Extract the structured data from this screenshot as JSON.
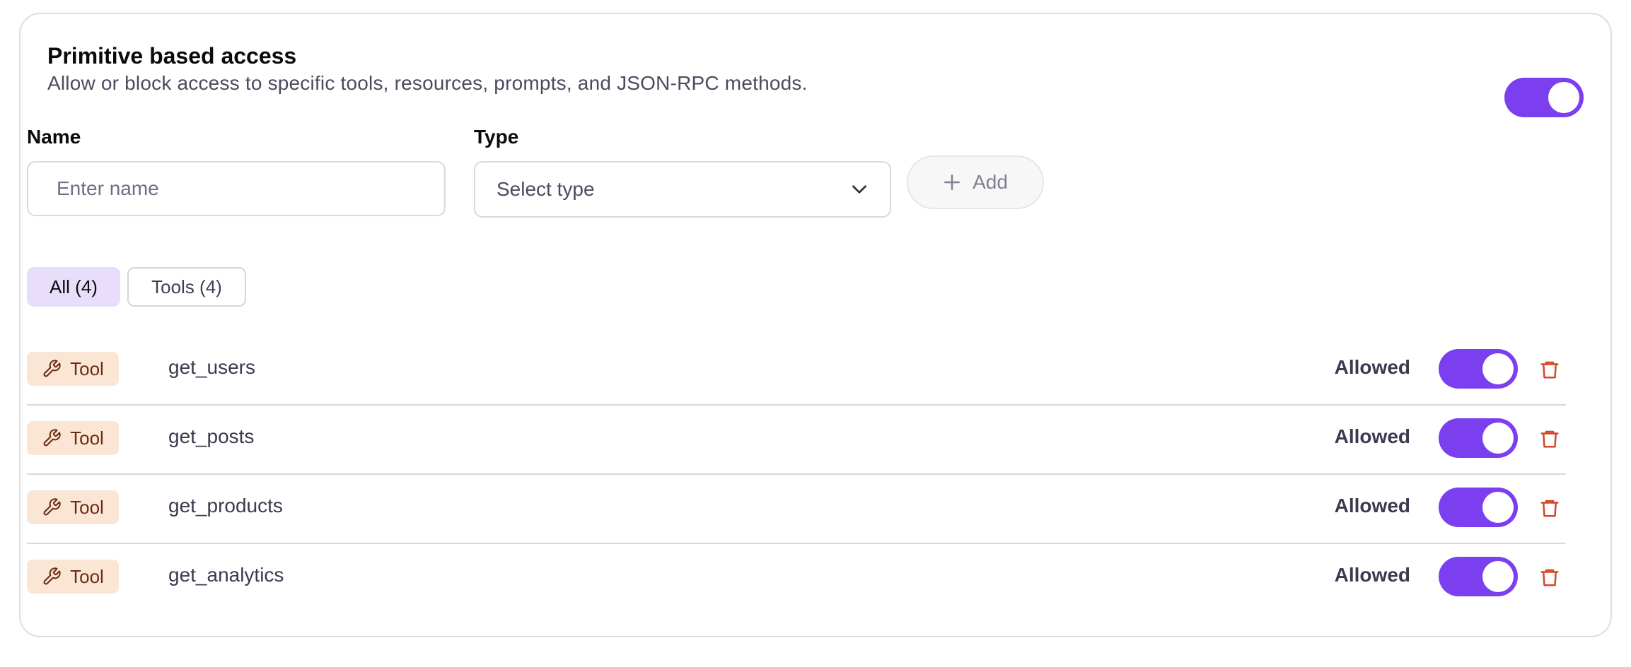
{
  "header": {
    "title": "Primitive based access",
    "subtitle": "Allow or block access to specific tools, resources, prompts, and JSON-RPC methods.",
    "enabled": true
  },
  "form": {
    "name_label": "Name",
    "name_placeholder": "Enter name",
    "name_value": "",
    "type_label": "Type",
    "type_selected": "Select type",
    "add_label": "Add"
  },
  "filters": [
    {
      "label": "All (4)",
      "active": true
    },
    {
      "label": "Tools (4)",
      "active": false
    }
  ],
  "rows": [
    {
      "type": "Tool",
      "name": "get_users",
      "status": "Allowed",
      "enabled": true
    },
    {
      "type": "Tool",
      "name": "get_posts",
      "status": "Allowed",
      "enabled": true
    },
    {
      "type": "Tool",
      "name": "get_products",
      "status": "Allowed",
      "enabled": true
    },
    {
      "type": "Tool",
      "name": "get_analytics",
      "status": "Allowed",
      "enabled": true
    }
  ],
  "icons": {
    "row_type": "wrench-icon",
    "delete": "trash-icon",
    "add": "plus-icon",
    "select": "chevron-down-icon"
  },
  "colors": {
    "accent": "#7b3ff0",
    "badge_bg": "#fbe6d6",
    "badge_text": "#6b2d12",
    "delete": "#d6452a",
    "active_filter_bg": "#e8ddfb"
  }
}
